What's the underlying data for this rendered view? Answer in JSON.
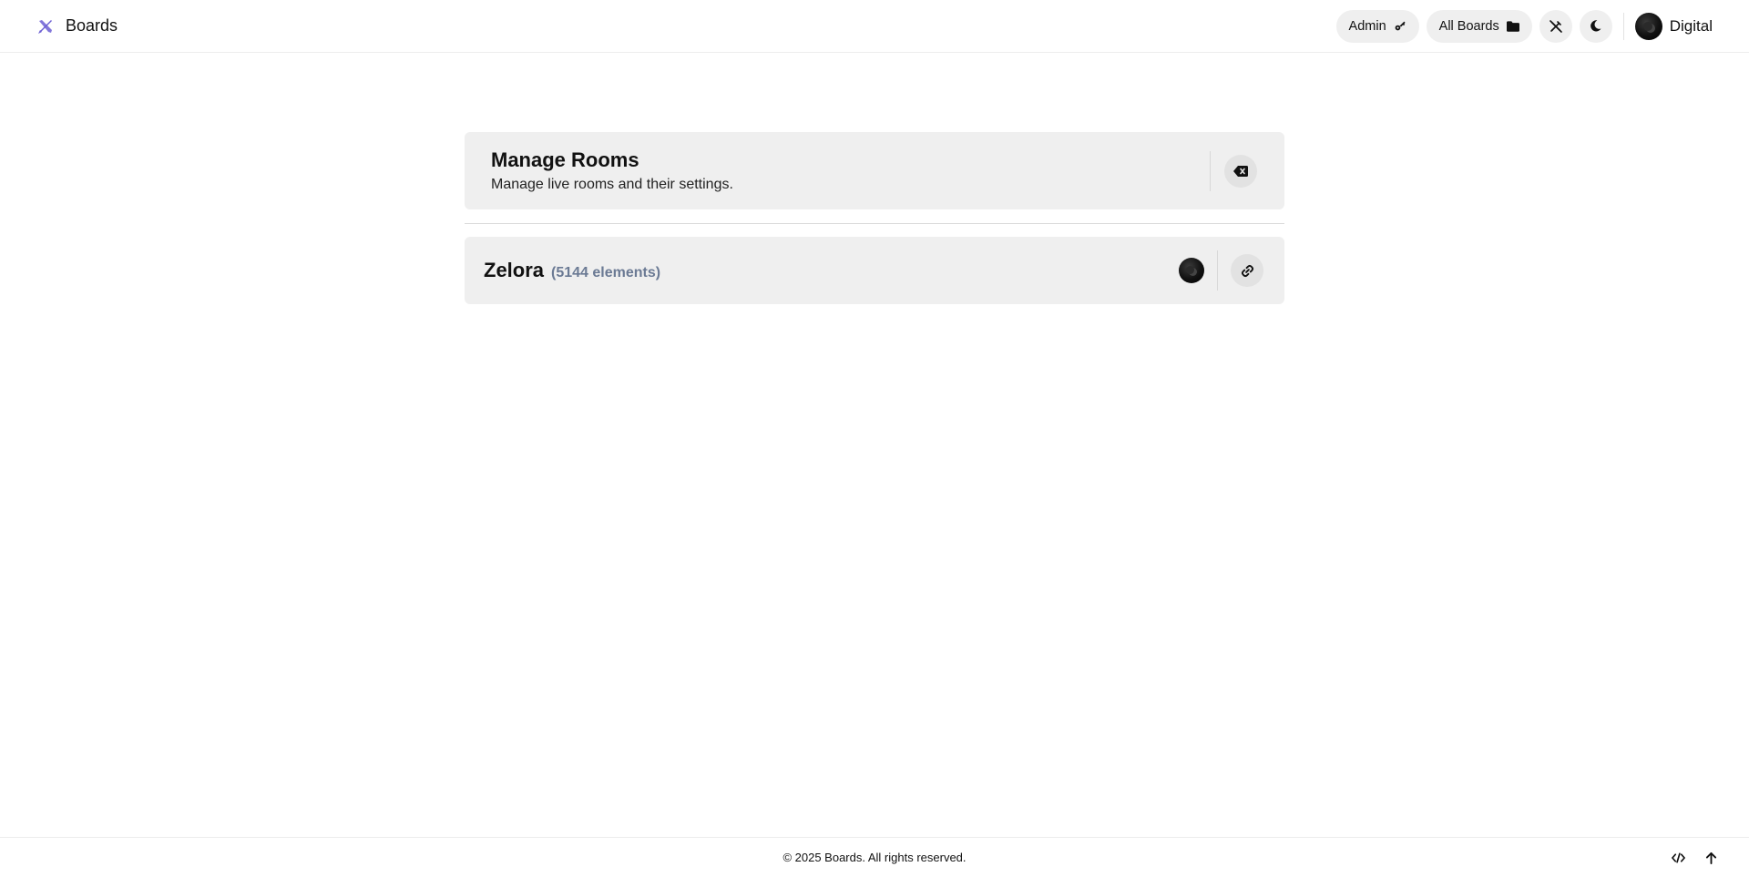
{
  "header": {
    "brand_name": "Boards",
    "admin_label": "Admin",
    "all_boards_label": "All Boards",
    "user_name": "Digital"
  },
  "icons": {
    "brand": "pencil-ruler-icon",
    "admin": "key-icon",
    "all_boards": "folder-icon",
    "toggle_tools": "pencil-off-icon",
    "theme": "moon-icon",
    "clear": "backspace-icon",
    "copy_link": "link-icon",
    "source": "code-icon",
    "scroll_top": "arrow-up-icon"
  },
  "manage": {
    "title": "Manage Rooms",
    "subtitle": "Manage live rooms and their settings."
  },
  "rooms": [
    {
      "name": "Zelora",
      "count": "(5144 elements)"
    }
  ],
  "footer": {
    "text": "© 2025 Boards. All rights reserved."
  },
  "colors": {
    "accent": "#6c5fd3",
    "card_bg": "#efefef",
    "muted_count": "#6b7a94"
  }
}
